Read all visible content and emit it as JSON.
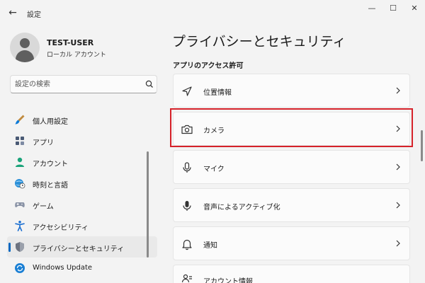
{
  "window": {
    "title": "設定",
    "back_glyph": "←",
    "min_glyph": "—",
    "max_glyph": "☐",
    "close_glyph": "✕"
  },
  "user": {
    "name": "TEST-USER",
    "account_type": "ローカル アカウント"
  },
  "search": {
    "placeholder": "設定の検索"
  },
  "sidebar": {
    "items": [
      {
        "label": "個人用設定",
        "icon": "brush-icon",
        "selected": false
      },
      {
        "label": "アプリ",
        "icon": "apps-icon",
        "selected": false
      },
      {
        "label": "アカウント",
        "icon": "account-icon",
        "selected": false
      },
      {
        "label": "時刻と言語",
        "icon": "globe-clock-icon",
        "selected": false
      },
      {
        "label": "ゲーム",
        "icon": "gamepad-icon",
        "selected": false
      },
      {
        "label": "アクセシビリティ",
        "icon": "accessibility-icon",
        "selected": false
      },
      {
        "label": "プライバシーとセキュリティ",
        "icon": "shield-icon",
        "selected": true
      },
      {
        "label": "Windows Update",
        "icon": "update-icon",
        "selected": false
      }
    ]
  },
  "main": {
    "title": "プライバシーとセキュリティ",
    "section": "アプリのアクセス許可",
    "items": [
      {
        "label": "位置情報",
        "icon": "location-icon"
      },
      {
        "label": "カメラ",
        "icon": "camera-icon",
        "highlighted": true
      },
      {
        "label": "マイク",
        "icon": "microphone-icon"
      },
      {
        "label": "音声によるアクティブ化",
        "icon": "voice-activation-icon"
      },
      {
        "label": "通知",
        "icon": "bell-icon"
      },
      {
        "label": "アカウント情報",
        "icon": "account-info-icon"
      }
    ]
  },
  "colors": {
    "accent": "#0067c0",
    "highlight": "#d6222a",
    "background": "#f3f3f3",
    "card": "#fbfbfb"
  }
}
